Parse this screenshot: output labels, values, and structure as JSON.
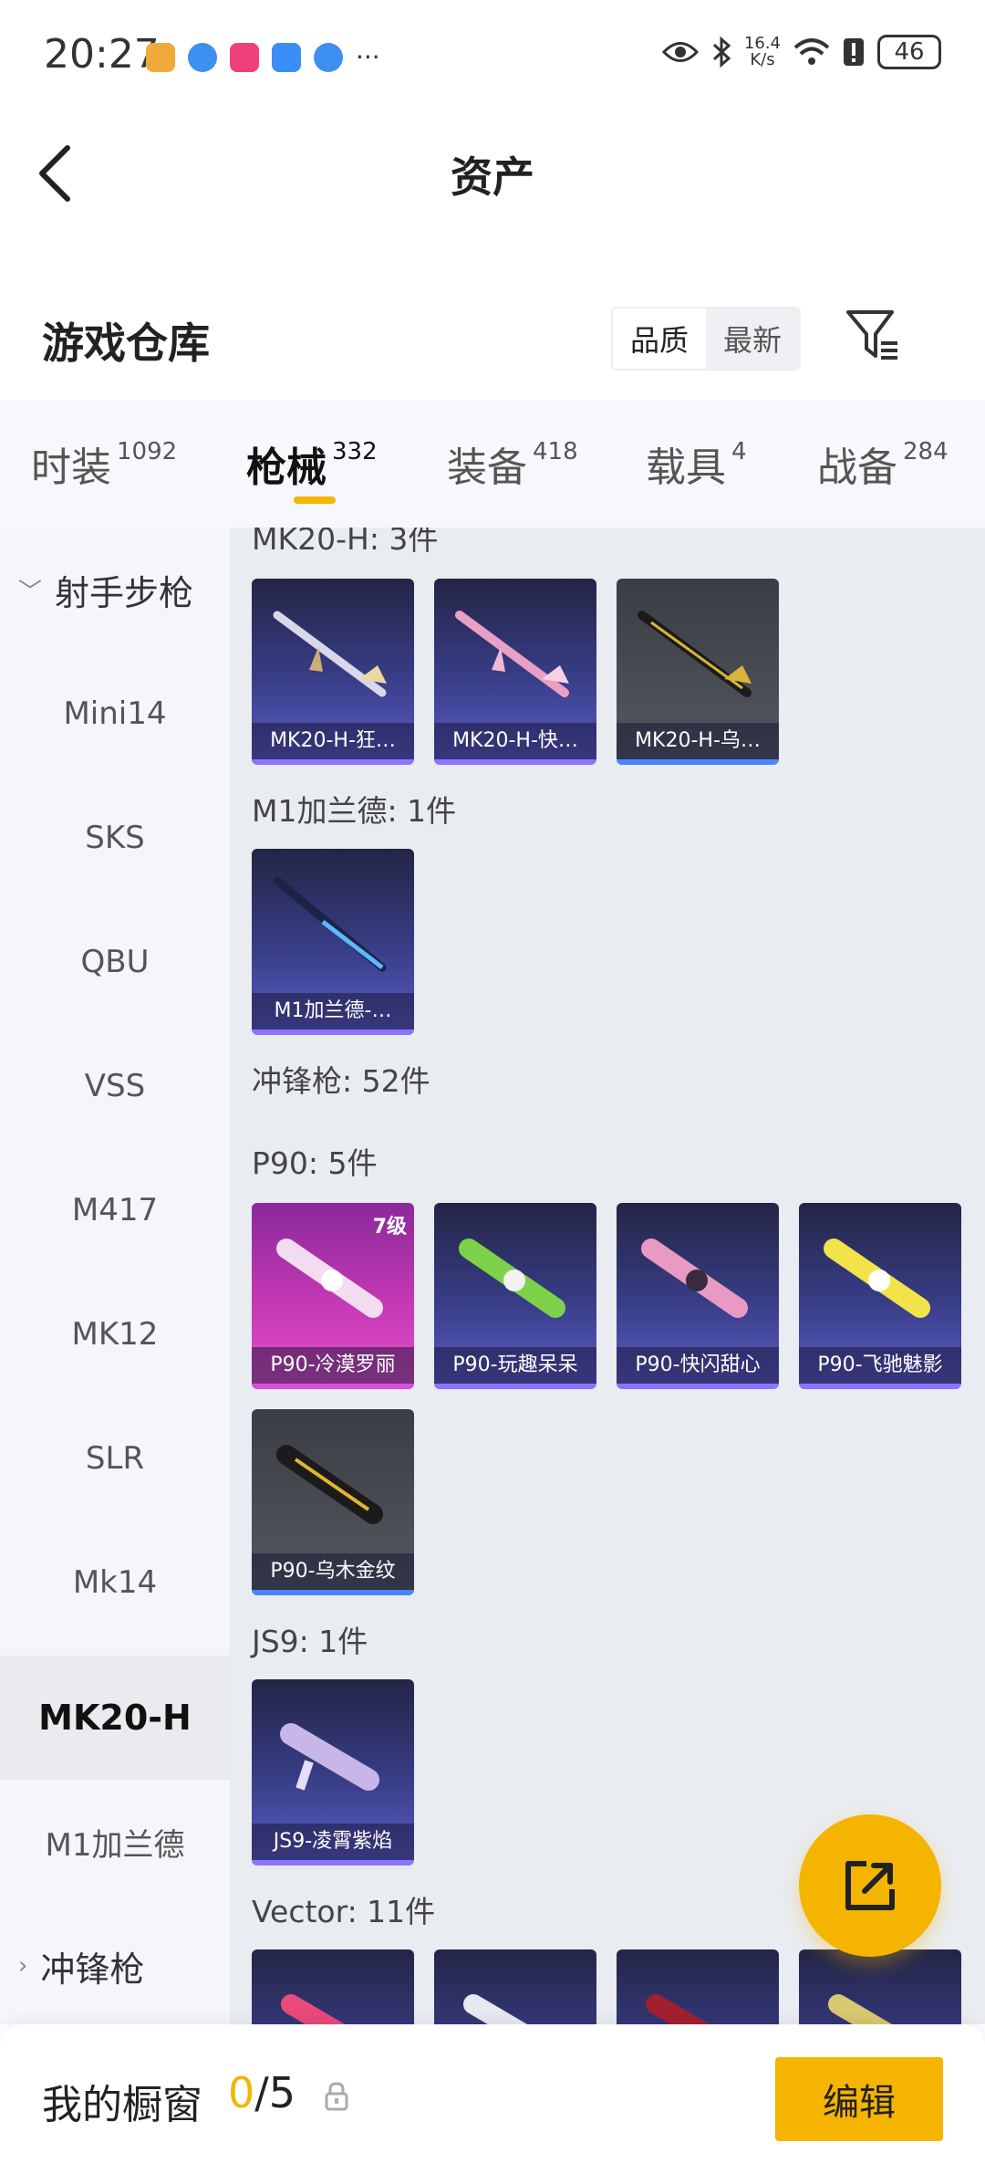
{
  "status_bar": {
    "time": "20:27",
    "net_speed_value": "16.4",
    "net_speed_unit": "K/s",
    "battery": "46",
    "more": "···"
  },
  "header": {
    "title": "资产",
    "back_icon": "chevron-left-icon"
  },
  "warehouse": {
    "title": "游戏仓库",
    "sort_options": [
      "品质",
      "最新"
    ],
    "active_sort": "品质",
    "filter_icon": "filter-icon"
  },
  "tabs": [
    {
      "label": "时装",
      "count": "1092"
    },
    {
      "label": "枪械",
      "count": "332"
    },
    {
      "label": "装备",
      "count": "418"
    },
    {
      "label": "载具",
      "count": "4"
    },
    {
      "label": "战备",
      "count": "284"
    }
  ],
  "active_tab": "枪械",
  "sidebar": {
    "category_open": "射手步枪",
    "items": [
      "Mini14",
      "SKS",
      "QBU",
      "VSS",
      "M417",
      "MK12",
      "SLR",
      "Mk14",
      "MK20-H",
      "M1加兰德"
    ],
    "active_item": "MK20-H",
    "category_closed": "冲锋枪"
  },
  "groups": [
    {
      "heading": "MK20-H: 3件",
      "items": [
        "MK20-H-狂…",
        "MK20-H-快…",
        "MK20-H-乌…"
      ]
    },
    {
      "heading": "M1加兰德: 1件",
      "items": [
        "M1加兰德-…"
      ]
    },
    {
      "heading": "冲锋枪: 52件",
      "items": []
    },
    {
      "heading": "P90: 5件",
      "items": [
        "P90-冷漠罗丽",
        "P90-玩趣呆呆",
        "P90-快闪甜心",
        "P90-飞驰魅影",
        "P90-乌木金纹"
      ],
      "badge": "7级"
    },
    {
      "heading": "JS9: 1件",
      "items": [
        "JS9-凌霄紫焰"
      ]
    },
    {
      "heading": "Vector: 11件",
      "items": []
    }
  ],
  "colors": {
    "accent": "#f5b400",
    "purple_card": "#383d86",
    "pink_card": "#c93ab6",
    "gray_card": "#55585f"
  },
  "bottom_bar": {
    "label": "我的橱窗",
    "count_current": "0",
    "count_total": "/5",
    "lock_icon": "lock-icon",
    "edit_label": "编辑"
  },
  "fab_icon": "share-out-icon"
}
